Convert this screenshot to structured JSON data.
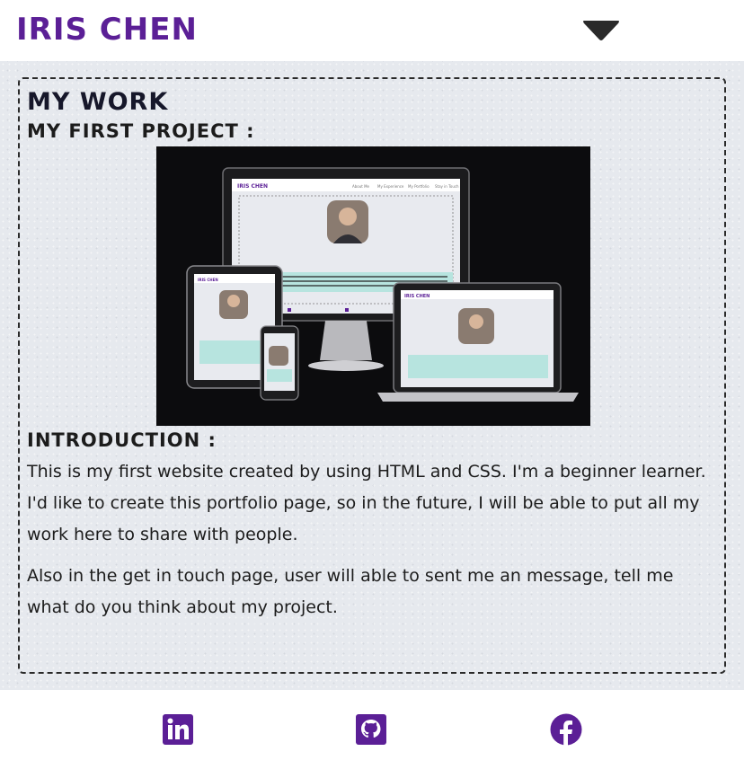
{
  "header": {
    "brand": "IRIS CHEN",
    "menu_icon": "caret-down-icon"
  },
  "main": {
    "section_title": "MY WORK",
    "project_title": "MY FIRST PROJECT :",
    "screenshot": {
      "brand": "IRIS CHEN",
      "nav_items": [
        "About Me",
        "My Experience",
        "My Portfolio",
        "Stay in Touch"
      ]
    },
    "intro_heading": "INTRODUCTION :",
    "paragraphs": [
      "This is my first website created by using HTML and CSS. I'm a beginner learner. I'd like to create this portfolio page, so in the future, I will be able to put all my work here to share with people.",
      "Also in the get in touch page, user will able to sent me an message, tell me what do you think about my project."
    ]
  },
  "footer": {
    "icons": [
      "linkedin-icon",
      "github-icon",
      "facebook-icon"
    ]
  },
  "colors": {
    "brand_purple": "#5b1f96",
    "page_bg": "#e6e9ee",
    "text": "#1c1c1c"
  }
}
